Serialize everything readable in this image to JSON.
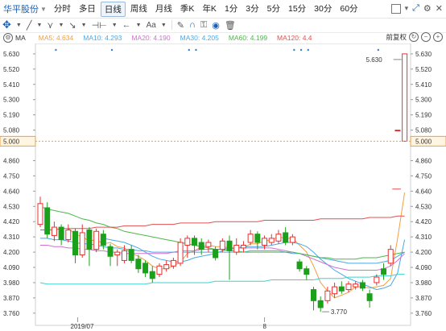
{
  "toolbar": {
    "stock_name": "华平股份",
    "periods": [
      "分时",
      "多日",
      "日线",
      "周线",
      "月线",
      "季K",
      "年K",
      "1分",
      "3分",
      "5分",
      "15分",
      "30分",
      "60分"
    ],
    "active_period": "日线"
  },
  "ma_legend": {
    "label": "MA",
    "items": [
      {
        "text": "MA5: 4.634",
        "color": "#f0a040"
      },
      {
        "text": "MA10: 4.293",
        "color": "#4aa8e8"
      },
      {
        "text": "MA20: 4.190",
        "color": "#d070d0"
      },
      {
        "text": "MA30: 4.205",
        "color": "#4aa8e8"
      },
      {
        "text": "MA60: 4.199",
        "color": "#4ab848"
      },
      {
        "text": "MA120: 4.4",
        "color": "#e05050"
      }
    ],
    "fq_label": "前复权"
  },
  "price_labels": {
    "current": "5.000",
    "high_marker": "5.630",
    "low_marker": "3.770"
  },
  "colors": {
    "up": "#e83030",
    "down": "#1aa01a",
    "current_line": "#f0a040"
  },
  "chart_data": {
    "type": "candlestick",
    "title": "华平股份",
    "x_ticks": [
      "2019/07",
      "8"
    ],
    "ylim": [
      3.73,
      5.67
    ],
    "y_ticks": [
      "5.630",
      "5.520",
      "5.410",
      "5.300",
      "5.190",
      "5.080",
      "5.000",
      "4.860",
      "4.750",
      "4.640",
      "4.530",
      "4.420",
      "4.310",
      "4.200",
      "4.090",
      "3.980",
      "3.870",
      "3.760"
    ],
    "current_price": 5.0,
    "annotations": [
      {
        "price": 5.63,
        "text": "5.630"
      },
      {
        "price": 3.77,
        "text": "3.770"
      }
    ],
    "candles": [
      [
        4.4,
        4.55,
        4.6,
        4.38
      ],
      [
        4.52,
        4.33,
        4.56,
        4.3
      ],
      [
        4.32,
        4.38,
        4.42,
        4.28
      ],
      [
        4.38,
        4.29,
        4.4,
        4.25
      ],
      [
        4.29,
        4.36,
        4.4,
        4.27
      ],
      [
        4.35,
        4.18,
        4.37,
        4.12
      ],
      [
        4.18,
        4.34,
        4.4,
        4.16
      ],
      [
        4.36,
        4.22,
        4.38,
        4.1
      ],
      [
        4.22,
        4.35,
        4.37,
        4.2
      ],
      [
        4.33,
        4.25,
        4.36,
        4.22
      ],
      [
        4.24,
        4.17,
        4.26,
        4.1
      ],
      [
        4.18,
        4.2,
        4.22,
        4.1
      ],
      [
        4.14,
        4.21,
        4.25,
        4.12
      ],
      [
        4.22,
        4.14,
        4.25,
        4.12
      ],
      [
        4.15,
        4.08,
        4.18,
        4.05
      ],
      [
        4.12,
        4.05,
        4.14,
        4.02
      ],
      [
        4.06,
        4.01,
        4.1,
        3.98
      ],
      [
        4.04,
        4.1,
        4.12,
        4.02
      ],
      [
        4.08,
        4.11,
        4.14,
        4.06
      ],
      [
        4.1,
        4.14,
        4.16,
        4.08
      ],
      [
        4.12,
        4.27,
        4.3,
        4.1
      ],
      [
        4.25,
        4.3,
        4.32,
        4.16
      ],
      [
        4.3,
        4.25,
        4.32,
        4.18
      ],
      [
        4.27,
        4.22,
        4.3,
        4.18
      ],
      [
        4.24,
        4.27,
        4.29,
        4.2
      ],
      [
        4.22,
        4.16,
        4.24,
        4.14
      ],
      [
        4.22,
        4.28,
        4.3,
        4.2
      ],
      [
        4.28,
        4.21,
        4.32,
        4.0
      ],
      [
        4.2,
        4.25,
        4.3,
        4.18
      ],
      [
        4.23,
        4.25,
        4.28,
        4.2
      ],
      [
        4.27,
        4.33,
        4.36,
        4.25
      ],
      [
        4.33,
        4.27,
        4.35,
        4.22
      ],
      [
        4.25,
        4.3,
        4.32,
        4.22
      ],
      [
        4.27,
        4.3,
        4.33,
        4.25
      ],
      [
        4.28,
        4.33,
        4.36,
        4.26
      ],
      [
        4.34,
        4.27,
        4.38,
        4.25
      ],
      [
        4.27,
        4.31,
        4.33,
        4.25
      ],
      [
        4.13,
        4.08,
        4.15,
        4.06
      ],
      [
        4.08,
        4.04,
        4.1,
        4.0
      ],
      [
        3.93,
        3.85,
        3.95,
        3.78
      ],
      [
        3.85,
        3.8,
        3.88,
        3.77
      ],
      [
        3.85,
        3.92,
        3.95,
        3.83
      ],
      [
        3.9,
        3.95,
        3.98,
        3.87
      ],
      [
        3.95,
        3.92,
        3.99,
        3.9
      ],
      [
        3.93,
        3.97,
        3.99,
        3.91
      ],
      [
        3.95,
        3.97,
        3.99,
        3.93
      ],
      [
        3.98,
        3.94,
        4.0,
        3.92
      ],
      [
        3.9,
        3.85,
        3.93,
        3.8
      ],
      [
        3.98,
        4.02,
        4.04,
        3.96
      ],
      [
        4.08,
        4.04,
        4.12,
        4.0
      ],
      [
        4.12,
        4.22,
        4.25,
        4.1
      ],
      [
        5.08,
        5.08,
        5.08,
        5.08
      ],
      [
        5.0,
        5.63,
        5.63,
        5.0
      ]
    ],
    "ma_lines": [
      {
        "name": "MA5",
        "color": "#f0a040",
        "values": [
          null,
          null,
          null,
          null,
          4.37,
          4.33,
          4.31,
          4.28,
          4.29,
          4.26,
          4.27,
          4.24,
          4.23,
          4.19,
          4.17,
          4.14,
          4.1,
          4.08,
          4.08,
          4.1,
          4.13,
          4.19,
          4.21,
          4.24,
          4.25,
          4.24,
          4.24,
          4.23,
          4.23,
          4.23,
          4.26,
          4.26,
          4.28,
          4.29,
          4.31,
          4.3,
          4.3,
          4.25,
          4.2,
          4.1,
          3.98,
          3.92,
          3.87,
          3.89,
          3.91,
          3.95,
          3.95,
          3.94,
          3.95,
          3.96,
          4.01,
          4.3,
          4.63
        ]
      },
      {
        "name": "MA10",
        "color": "#4aa8e8",
        "values": [
          null,
          null,
          null,
          null,
          null,
          null,
          null,
          null,
          null,
          4.3,
          4.29,
          4.28,
          4.27,
          4.25,
          4.23,
          4.2,
          4.17,
          4.15,
          4.14,
          4.13,
          4.13,
          4.14,
          4.16,
          4.17,
          4.18,
          4.19,
          4.21,
          4.22,
          4.23,
          4.24,
          4.24,
          4.24,
          4.24,
          4.25,
          4.26,
          4.27,
          4.27,
          4.26,
          4.24,
          4.2,
          4.15,
          4.11,
          4.07,
          4.04,
          4.01,
          3.99,
          3.97,
          3.95,
          3.93,
          3.94,
          3.96,
          4.05,
          4.29
        ]
      },
      {
        "name": "MA20",
        "color": "#d070d0",
        "values": [
          4.25,
          4.25,
          4.24,
          4.24,
          4.23,
          4.23,
          4.22,
          4.22,
          4.21,
          4.21,
          4.2,
          4.2,
          4.19,
          4.19,
          4.19,
          4.19,
          4.19,
          4.19,
          4.19,
          4.2,
          4.21,
          4.21,
          4.21,
          4.22,
          4.22,
          4.22,
          4.22,
          4.23,
          4.23,
          4.23,
          4.23,
          4.23,
          4.23,
          4.23,
          4.22,
          4.21,
          4.2,
          4.19,
          4.17,
          4.15,
          4.13,
          4.11,
          4.09,
          4.08,
          4.07,
          4.07,
          4.07,
          4.07,
          4.07,
          4.08,
          4.1,
          4.14,
          4.19
        ]
      },
      {
        "name": "MA30",
        "color": "#4aa8e8",
        "values": [
          4.3,
          4.3,
          4.29,
          4.29,
          4.28,
          4.27,
          4.26,
          4.26,
          4.25,
          4.24,
          4.23,
          4.23,
          4.22,
          4.22,
          4.21,
          4.21,
          4.2,
          4.2,
          4.2,
          4.2,
          4.2,
          4.2,
          4.2,
          4.2,
          4.2,
          4.2,
          4.2,
          4.2,
          4.2,
          4.2,
          4.21,
          4.21,
          4.21,
          4.21,
          4.21,
          4.2,
          4.19,
          4.19,
          4.18,
          4.17,
          4.16,
          4.15,
          4.14,
          4.13,
          4.12,
          4.12,
          4.12,
          4.12,
          4.12,
          4.13,
          4.14,
          4.17,
          4.2
        ]
      },
      {
        "name": "MA60",
        "color": "#4ab848",
        "values": [
          4.53,
          4.51,
          4.5,
          4.49,
          4.48,
          4.46,
          4.44,
          4.43,
          4.41,
          4.4,
          4.38,
          4.37,
          4.35,
          4.34,
          4.33,
          4.32,
          4.31,
          4.3,
          4.29,
          4.28,
          4.27,
          4.26,
          4.25,
          4.24,
          4.23,
          4.22,
          4.22,
          4.21,
          4.21,
          4.2,
          4.2,
          4.2,
          4.2,
          4.2,
          4.2,
          4.2,
          4.2,
          4.19,
          4.18,
          4.17,
          4.16,
          4.16,
          4.15,
          4.15,
          4.15,
          4.15,
          4.16,
          4.16,
          4.16,
          4.17,
          4.18,
          4.19,
          4.2
        ]
      },
      {
        "name": "MA120",
        "color": "#e05050",
        "values": [
          4.36,
          4.36,
          4.36,
          4.37,
          4.37,
          4.37,
          4.37,
          4.37,
          4.38,
          4.38,
          4.38,
          4.38,
          4.39,
          4.39,
          4.39,
          4.39,
          4.4,
          4.4,
          4.4,
          4.4,
          4.41,
          4.41,
          4.41,
          4.41,
          4.41,
          4.42,
          4.42,
          4.42,
          4.42,
          4.42,
          4.42,
          4.42,
          4.43,
          4.43,
          4.43,
          4.43,
          4.43,
          4.43,
          4.43,
          4.43,
          4.44,
          4.44,
          4.44,
          4.44,
          4.44,
          4.44,
          4.44,
          4.45,
          4.45,
          4.45,
          4.45,
          4.46,
          4.46
        ]
      },
      {
        "name": "Baseline",
        "color": "#40d0d0",
        "values": [
          3.98,
          3.97,
          3.97,
          3.97,
          3.97,
          3.97,
          3.97,
          3.97,
          3.97,
          3.97,
          3.97,
          3.97,
          3.97,
          3.97,
          3.97,
          3.97,
          3.98,
          3.98,
          3.98,
          3.98,
          3.98,
          3.98,
          3.98,
          3.98,
          3.98,
          3.99,
          3.99,
          3.99,
          3.99,
          3.99,
          3.99,
          3.99,
          3.99,
          4.0,
          4.0,
          4.0,
          4.0,
          4.0,
          4.0,
          4.0,
          4.01,
          4.01,
          4.01,
          4.01,
          4.02,
          4.02,
          4.02,
          4.02,
          4.03,
          4.03,
          4.03,
          4.04,
          4.04
        ]
      }
    ]
  }
}
